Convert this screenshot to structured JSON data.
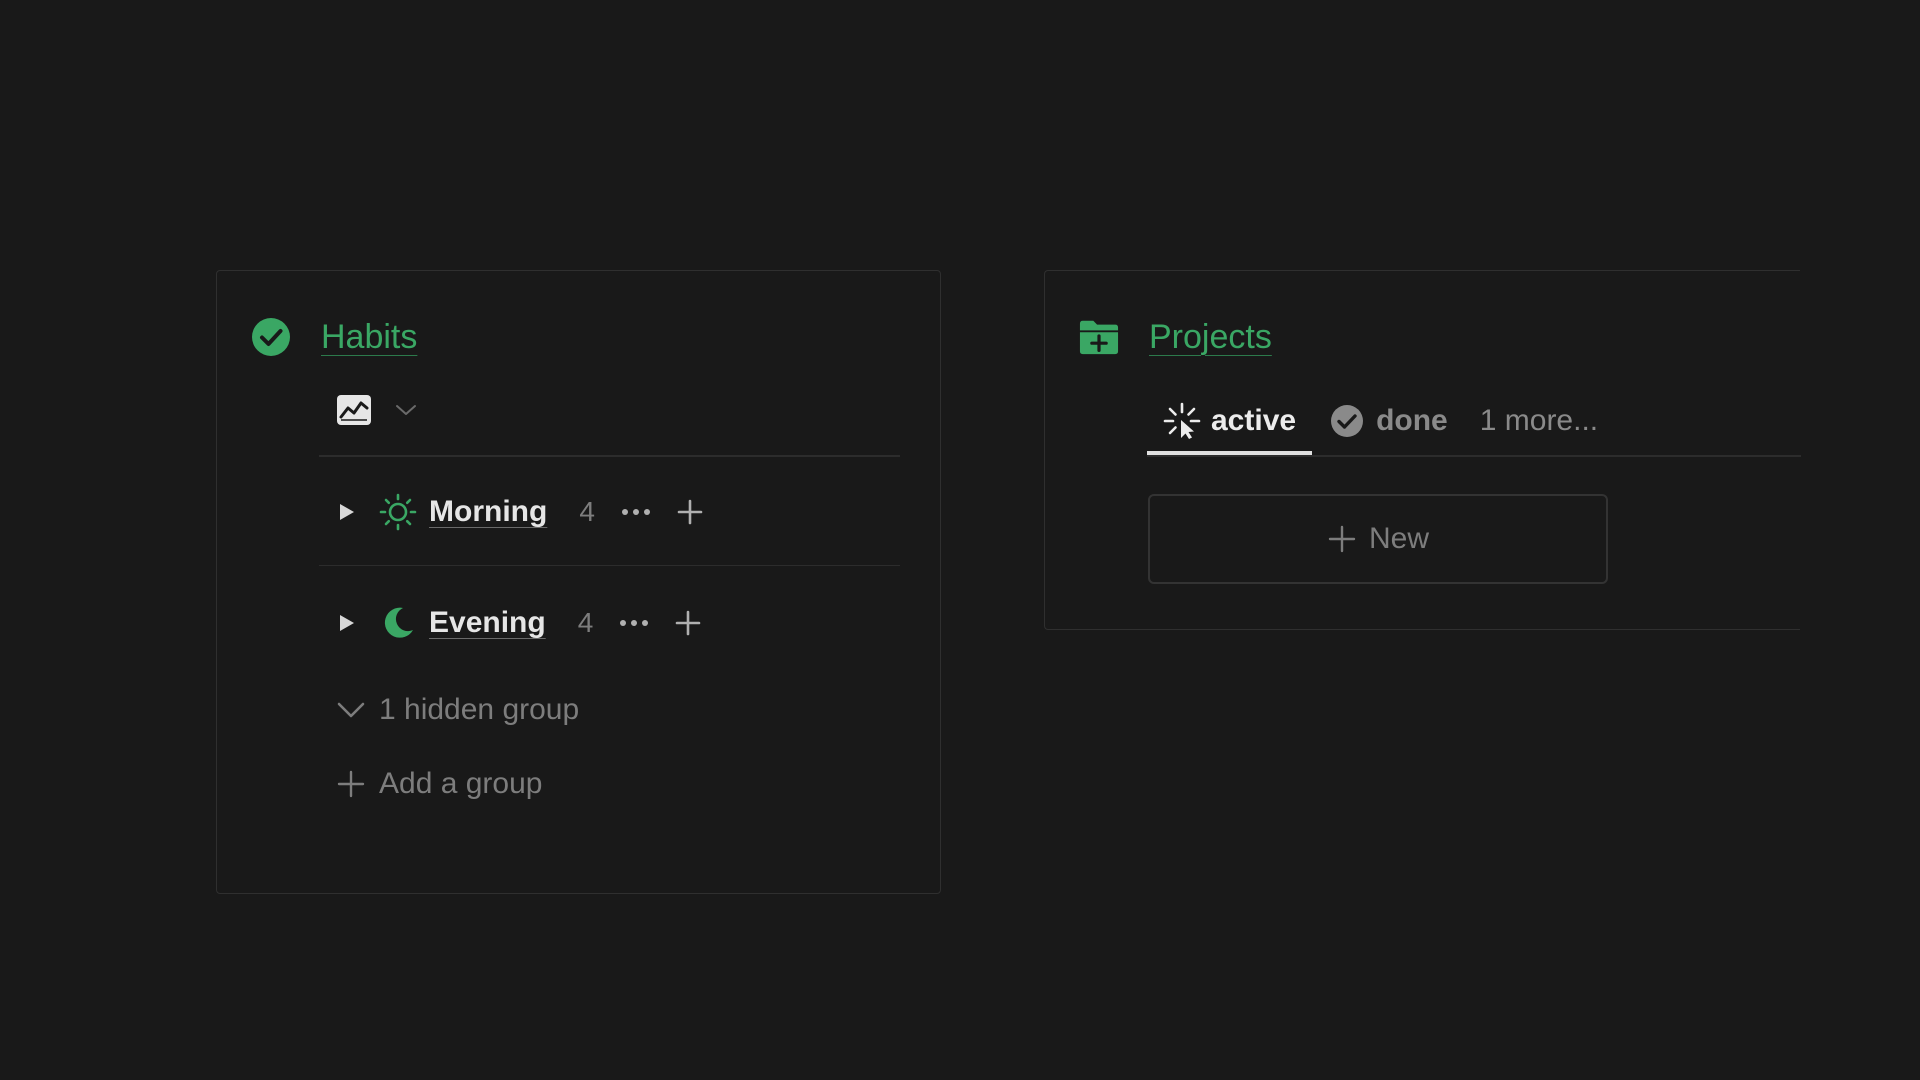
{
  "colors": {
    "background": "#191919",
    "accent_green": "#3aa764",
    "text_primary": "#e6e6e6",
    "text_muted": "#7d7d7d",
    "border": "#2f2f2f"
  },
  "habits": {
    "title": "Habits",
    "title_icon": "check-circle-icon",
    "view_icon": "chart-icon",
    "groups": [
      {
        "label": "Morning",
        "count": "4",
        "icon": "sun-icon"
      },
      {
        "label": "Evening",
        "count": "4",
        "icon": "moon-icon"
      }
    ],
    "hidden_groups_label": "1 hidden group",
    "add_group_label": "Add a group"
  },
  "projects": {
    "title": "Projects",
    "title_icon": "folder-plus-icon",
    "tabs": [
      {
        "label": "active",
        "icon": "loading-sparkle-icon",
        "selected": true
      },
      {
        "label": "done",
        "icon": "check-circle-icon",
        "selected": false
      }
    ],
    "more_tabs_label": "1 more...",
    "new_button_label": "New"
  }
}
